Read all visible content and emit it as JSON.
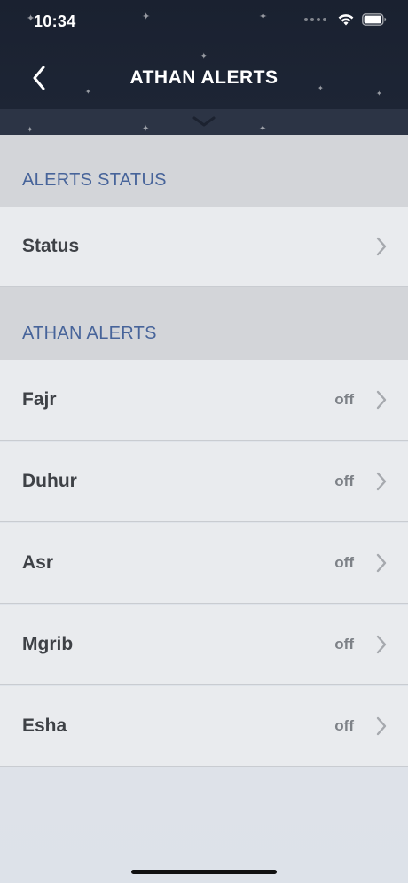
{
  "status_bar": {
    "time": "10:34"
  },
  "header": {
    "title": "ATHAN ALERTS",
    "back_icon": "chevron-left-icon",
    "collapse_icon": "chevron-down-icon"
  },
  "sections": {
    "alerts_status": {
      "title": "ALERTS STATUS",
      "rows": [
        {
          "label": "Status",
          "value": ""
        }
      ]
    },
    "athan_alerts": {
      "title": "ATHAN ALERTS",
      "rows": [
        {
          "label": "Fajr",
          "value": "off"
        },
        {
          "label": "Duhur",
          "value": "off"
        },
        {
          "label": "Asr",
          "value": "off"
        },
        {
          "label": "Mgrib",
          "value": "off"
        },
        {
          "label": "Esha",
          "value": "off"
        }
      ]
    }
  },
  "colors": {
    "header_bg": "#1b2230",
    "section_title": "#47649a",
    "row_bg": "#e9ebee",
    "section_bg": "#d3d5d9"
  }
}
